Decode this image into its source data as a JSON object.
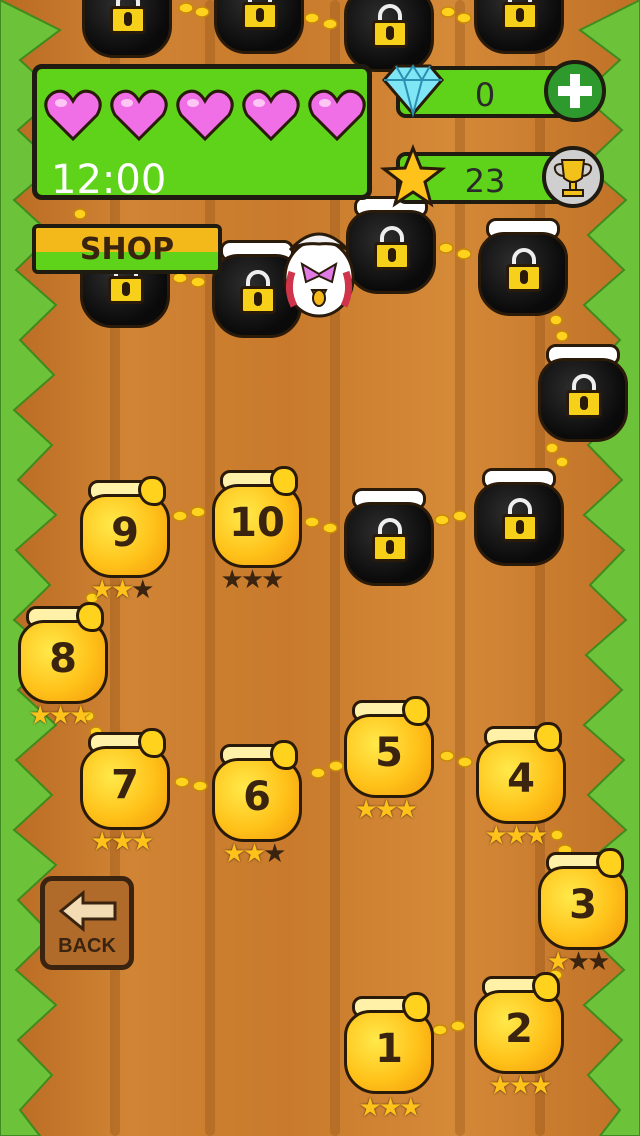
{
  "hud": {
    "lives": 5,
    "timer": "12:00",
    "gems": "0",
    "stars": "23"
  },
  "shop": {
    "label": "SHOP"
  },
  "back": {
    "label": "BACK"
  },
  "levels": [
    {
      "number": "1",
      "stars": 3
    },
    {
      "number": "2",
      "stars": 3
    },
    {
      "number": "3",
      "stars": 1
    },
    {
      "number": "4",
      "stars": 3
    },
    {
      "number": "5",
      "stars": 3
    },
    {
      "number": "6",
      "stars": 2
    },
    {
      "number": "7",
      "stars": 3
    },
    {
      "number": "8",
      "stars": 3
    },
    {
      "number": "9",
      "stars": 2
    },
    {
      "number": "10",
      "stars": 0
    }
  ],
  "colors": {
    "hud_green": "#5fd31a",
    "heart_pink": "#f06ee6",
    "honey": "#ffc21a",
    "wood": "#c97a2c"
  },
  "icons": [
    "heart-icon",
    "diamond-icon",
    "plus-icon",
    "star-icon",
    "trophy-icon",
    "lock-icon",
    "back-arrow-icon"
  ]
}
